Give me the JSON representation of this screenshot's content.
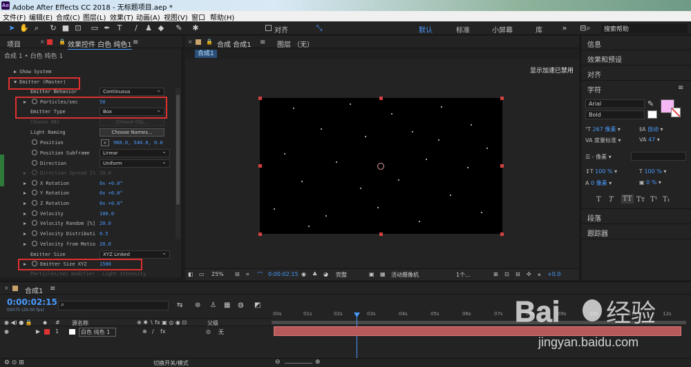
{
  "window": {
    "title": "Adobe After Effects CC 2018 - 无标题项目.aep *",
    "app_icon": "Ae"
  },
  "menu": [
    "文件(F)",
    "编辑(E)",
    "合成(C)",
    "图层(L)",
    "效果(T)",
    "动画(A)",
    "视图(V)",
    "窗口",
    "帮助(H)"
  ],
  "toolbar": {
    "align_label": "对齐",
    "workspaces": [
      "默认",
      "标准",
      "小屏幕",
      "库"
    ],
    "search_placeholder": "搜索帮助"
  },
  "left_panel": {
    "tabs": {
      "project": "项目",
      "effects": "效果控件 白色 纯色1"
    },
    "subheader": "合成 1 • 白色 纯色 1",
    "rows": {
      "show_system": "Show System",
      "emitter_master": "Emitter (Master)",
      "emitter_behavior": "Emitter Behavior",
      "emitter_behavior_value": "Continuous",
      "particles_sec": "Particles/sec",
      "particles_sec_value": "50",
      "emitter_type": "Emitter Type",
      "emitter_type_value": "Box",
      "choose_obj": "Choose OBJ",
      "choose_obj_btn": "Choose Obj...",
      "light_naming": "Light Naming",
      "light_naming_btn": "Choose Names...",
      "position": "Position",
      "position_value": "960.0, 540.0, 0.0",
      "position_subframe": "Position Subframe",
      "position_subframe_value": "Linear",
      "direction": "Direction",
      "direction_value": "Uniform",
      "direction_spread": "Direction Spread [%",
      "direction_spread_value": "20.0",
      "x_rotation": "X Rotation",
      "x_rotation_value": "0x +0.0°",
      "y_rotation": "Y Rotation",
      "y_rotation_value": "0x +0.0°",
      "z_rotation": "Z Rotation",
      "z_rotation_value": "0x +0.0°",
      "velocity": "Velocity",
      "velocity_value": "100.0",
      "velocity_random": "Velocity Random [%]",
      "velocity_random_value": "20.0",
      "velocity_distrib": "Velocity Distributi",
      "velocity_distrib_value": "0.5",
      "velocity_from_motion": "Velocity from Motio",
      "velocity_from_motion_value": "20.0",
      "emitter_size": "Emitter Size",
      "emitter_size_value": "XYZ Linked",
      "emitter_size_xyz": "Emitter Size XYZ",
      "emitter_size_xyz_value": "1500",
      "particles_modifier": "Particles/sec modifier",
      "particles_modifier_value": "Light Intensity"
    }
  },
  "comp_panel": {
    "tab_comp": "合成 合成1",
    "tab_layer": "图层 （无）",
    "flow_label": "合成1",
    "render_note": "显示加速已禁用",
    "footer": {
      "zoom": "25%",
      "timecode": "0:00:02:15",
      "resolution": "完整",
      "camera": "活动摄像机",
      "views": "1个...",
      "exposure": "+0.0"
    }
  },
  "right_panel": {
    "items": [
      "信息",
      "效果和预设",
      "对齐",
      "字符",
      "段落",
      "跟踪器"
    ],
    "font_family": "Arial",
    "font_style": "Bold",
    "font_size": "267 像素",
    "leading": "自动",
    "kerning": "度量标准",
    "tracking": "47",
    "stroke": "- 像素",
    "vscale": "100 %",
    "hscale": "100 %",
    "baseline": "0 像素",
    "tsume": "0 %",
    "fill_color": "#f5b8f5",
    "text_styles": [
      "T",
      "T",
      "TT",
      "Tт",
      "T¹",
      "T₁"
    ]
  },
  "timeline": {
    "tab": "合成1",
    "timecode": "0:00:02:15",
    "timecode_sub": "00075 (29.00 fps)",
    "cols": {
      "source": "源名称",
      "parent": "父级"
    },
    "layer": {
      "index": "1",
      "name": "白色 纯色 1",
      "parent": "无"
    },
    "ruler": [
      "00s",
      "01s",
      "02s",
      "03s",
      "04s",
      "05s",
      "06s",
      "07s",
      "08s",
      "09s",
      "10s",
      "11s",
      "12s"
    ],
    "footer_label": "切换开关/模式",
    "layer_color": "#b85a5c"
  },
  "watermark": {
    "brand": "Bai",
    "brand2": "经验",
    "url": "jingyan.baidu.com"
  }
}
